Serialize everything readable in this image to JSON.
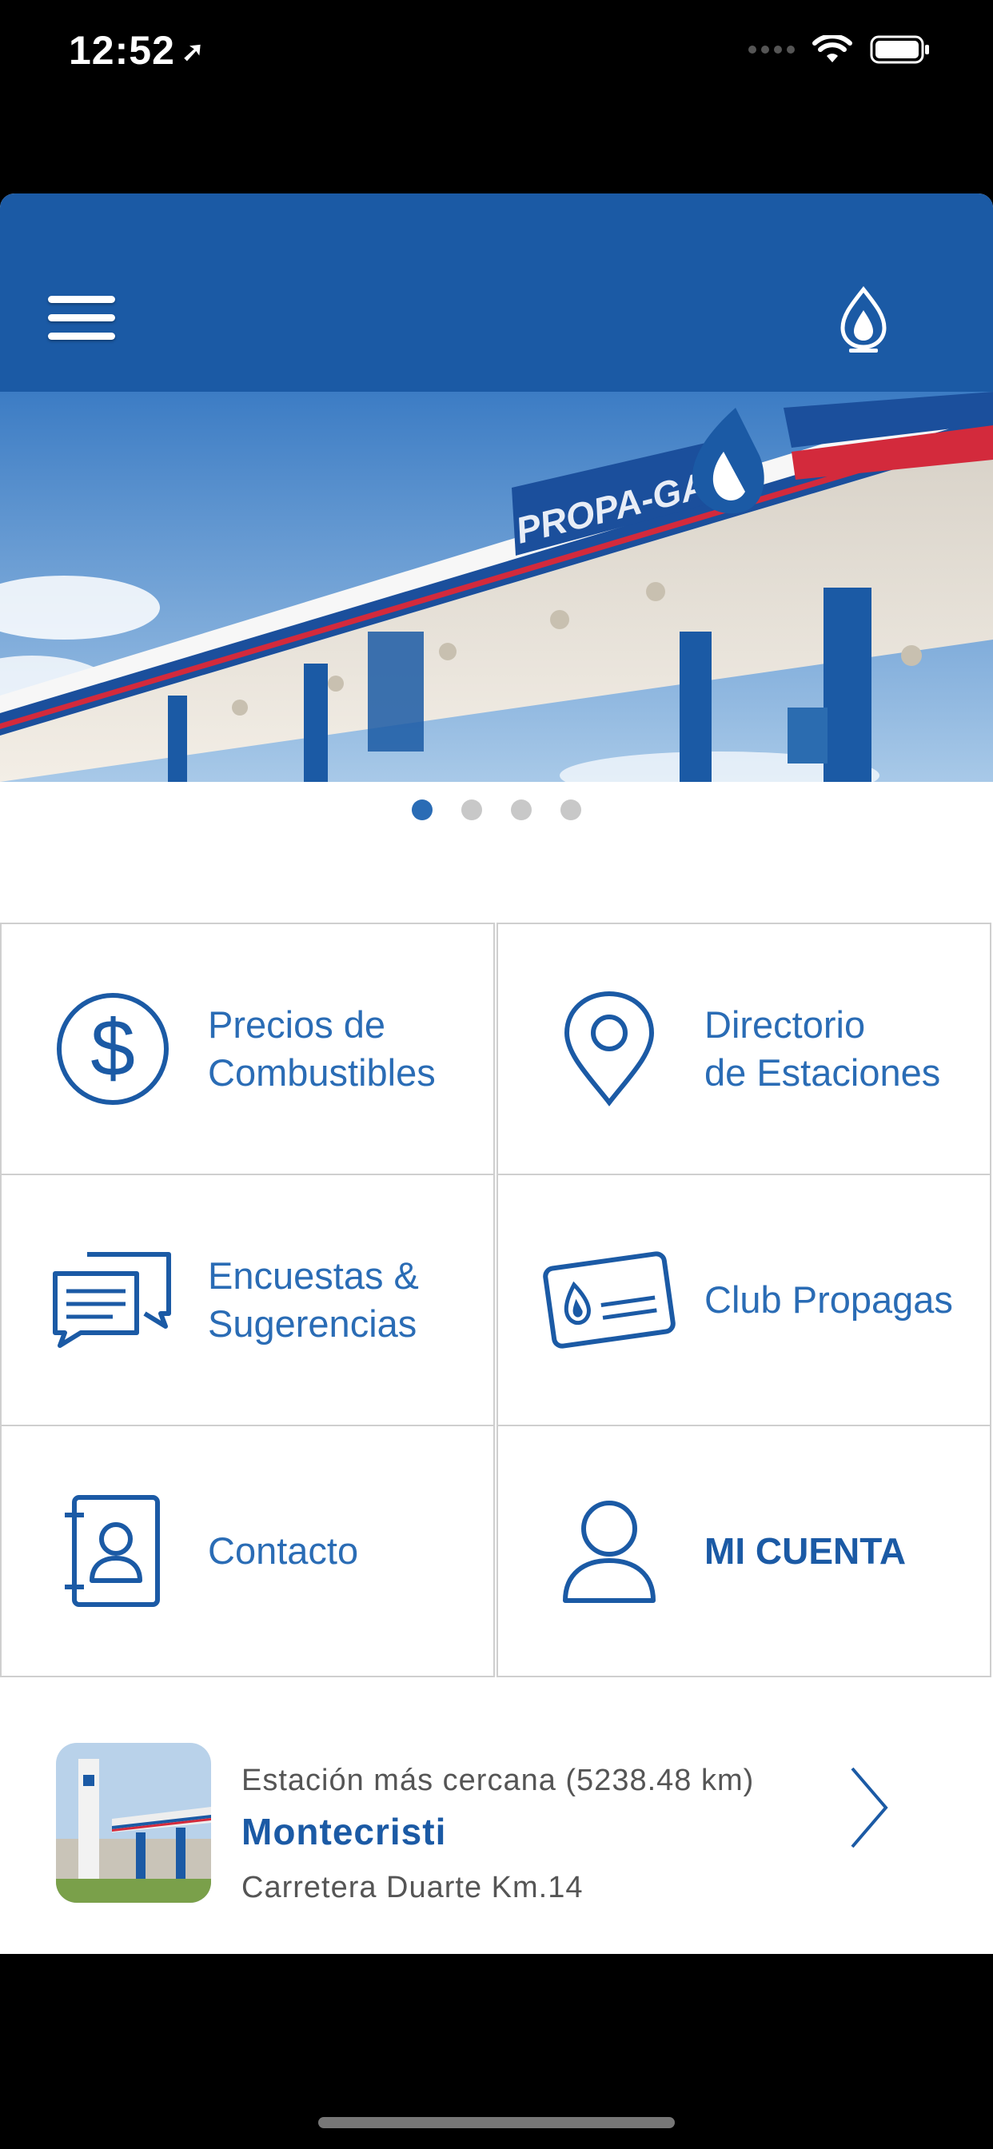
{
  "status_bar": {
    "time": "12:52"
  },
  "header": {
    "menu_icon": "hamburger-menu-icon",
    "logo_icon": "propagas-flame-icon"
  },
  "banner": {
    "brand_text": "PROPA-GAS",
    "slides_total": 4,
    "active_slide": 1
  },
  "menu": [
    {
      "label": "Precios de\nCombustibles",
      "icon": "dollar-circle-icon"
    },
    {
      "label": "Directorio\nde Estaciones",
      "icon": "location-pin-icon"
    },
    {
      "label": "Encuestas &\nSugerencias",
      "icon": "chat-bubbles-icon"
    },
    {
      "label": "Club Propagas",
      "icon": "membership-card-icon"
    },
    {
      "label": "Contacto",
      "icon": "contact-book-icon"
    },
    {
      "label": "MI CUENTA",
      "icon": "user-icon"
    }
  ],
  "nearest_station": {
    "caption": "Estación más cercana (5238.48 km)",
    "name": "Montecristi",
    "address": "Carretera Duarte Km.14"
  },
  "colors": {
    "primary": "#1b5aa5",
    "accent": "#2a6cb5",
    "stripe_red": "#d32a3c"
  }
}
